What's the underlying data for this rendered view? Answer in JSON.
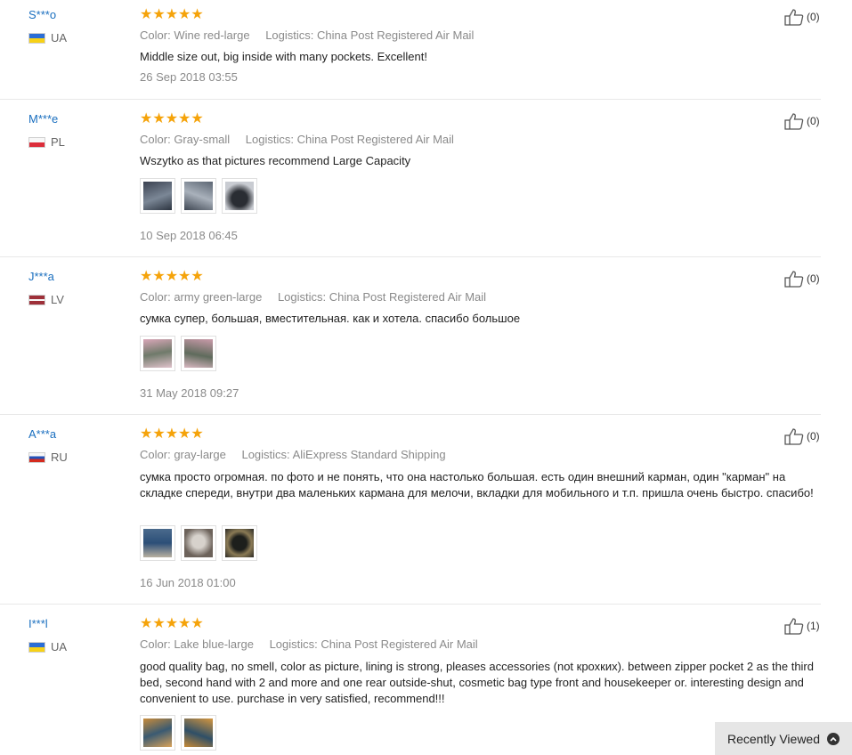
{
  "colors": {
    "star": "#f5a30a",
    "link": "#1a6fbf",
    "muted": "#8a8a8a"
  },
  "labels": {
    "color": "Color:",
    "logistics": "Logistics:"
  },
  "reviews": [
    {
      "user": "S***o",
      "country": "UA",
      "flag": "ua",
      "rating": "★★★★★",
      "color": "Wine red-large",
      "logistics": "China Post Registered Air Mail",
      "text": "Middle size out, big inside with many pockets. Excellent!",
      "images": [],
      "date": "26 Sep 2018 03:55",
      "helpful": "(0)"
    },
    {
      "user": "M***e",
      "country": "PL",
      "flag": "pl",
      "rating": "★★★★★",
      "color": "Gray-small",
      "logistics": "China Post Registered Air Mail",
      "text": "Wszytko as that pictures recommend Large Capacity",
      "images": [
        "photo-gray-1",
        "photo-gray-2",
        "photo-gray-3"
      ],
      "date": "10 Sep 2018 06:45",
      "helpful": "(0)"
    },
    {
      "user": "J***a",
      "country": "LV",
      "flag": "lv",
      "rating": "★★★★★",
      "color": "army green-large",
      "logistics": "China Post Registered Air Mail",
      "text": "сумка супер, большая, вместительная. как и хотела. спасибо большое",
      "images": [
        "photo-green-1",
        "photo-green-2"
      ],
      "date": "31 May 2018 09:27",
      "helpful": "(0)"
    },
    {
      "user": "A***a",
      "country": "RU",
      "flag": "ru",
      "rating": "★★★★★",
      "color": "gray-large",
      "logistics": "AliExpress Standard Shipping",
      "text": "сумка просто огромная. по фото и не понять, что она настолько большая. есть один внешний карман, один \"карман\" на складке спереди, внутри два маленьких кармана для мелочи, вкладки для мобильного и т.п. пришла очень быстро. спасибо!",
      "images": [
        "photo-gray-large-1",
        "photo-gray-large-2",
        "photo-gray-large-3"
      ],
      "date": "16 Jun 2018 01:00",
      "helpful": "(0)"
    },
    {
      "user": "I***l",
      "country": "UA",
      "flag": "ua",
      "rating": "★★★★★",
      "color": "Lake blue-large",
      "logistics": "China Post Registered Air Mail",
      "text": "good quality bag, no smell, color as picture, lining is strong, pleases accessories (not крохких). between zipper pocket 2 as the third bed, second hand with 2 and more and one rear outside-shut, cosmetic bag type front and housekeeper or. interesting design and convenient to use. purchase in very satisfied, recommend!!!",
      "images": [
        "photo-blue-1",
        "photo-blue-2"
      ],
      "date": "",
      "helpful": "(1)"
    }
  ],
  "recently_viewed": {
    "label": "Recently Viewed",
    "icon": "chevron-up-icon"
  }
}
